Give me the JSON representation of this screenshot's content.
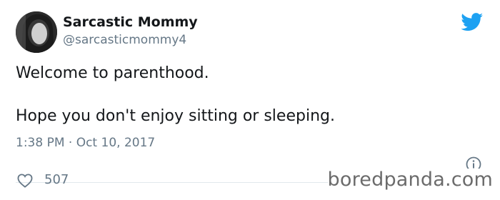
{
  "author": {
    "display_name": "Sarcastic Mommy",
    "handle": "@sarcasticmommy4"
  },
  "tweet": {
    "line1": "Welcome to parenthood.",
    "line2": "Hope you don't enjoy sitting or sleeping.",
    "timestamp": "1:38 PM · Oct 10, 2017"
  },
  "engagement": {
    "likes": "507"
  },
  "watermark": "boredpanda.com",
  "icons": {
    "brand": "twitter-bird-icon",
    "info": "info-icon",
    "like": "heart-icon"
  },
  "colors": {
    "text": "#14171a",
    "secondary": "#657786",
    "twitter_blue": "#1da1f2",
    "divider": "#e1e8ed"
  }
}
